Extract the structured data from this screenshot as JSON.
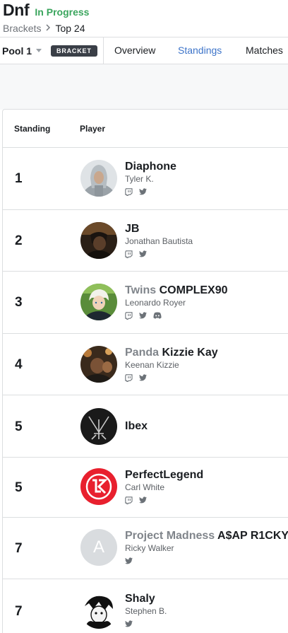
{
  "header": {
    "title": "Dnf",
    "status": "In Progress",
    "breadcrumb": {
      "parent": "Brackets",
      "current": "Top 24"
    }
  },
  "tabbar": {
    "pool_label": "Pool 1",
    "bracket_badge": "BRACKET",
    "tabs": [
      {
        "label": "Overview",
        "active": false
      },
      {
        "label": "Standings",
        "active": true
      },
      {
        "label": "Matches",
        "active": false
      }
    ]
  },
  "table": {
    "headers": {
      "standing": "Standing",
      "player": "Player"
    },
    "rows": [
      {
        "standing": "1",
        "prefix": "",
        "gamertag": "Diaphone",
        "name": "Tyler K.",
        "socials": [
          "twitch-icon",
          "twitter-icon"
        ]
      },
      {
        "standing": "2",
        "prefix": "",
        "gamertag": "JB",
        "name": "Jonathan Bautista",
        "socials": [
          "twitch-icon",
          "twitter-icon"
        ]
      },
      {
        "standing": "3",
        "prefix": "Twins",
        "gamertag": "COMPLEX90",
        "name": "Leonardo Royer",
        "socials": [
          "twitch-icon",
          "twitter-icon",
          "discord-icon"
        ]
      },
      {
        "standing": "4",
        "prefix": "Panda",
        "gamertag": "Kizzie Kay",
        "name": "Keenan Kizzie",
        "socials": [
          "twitch-icon",
          "twitter-icon"
        ]
      },
      {
        "standing": "5",
        "prefix": "",
        "gamertag": "Ibex",
        "name": "",
        "socials": []
      },
      {
        "standing": "5",
        "prefix": "",
        "gamertag": "PerfectLegend",
        "name": "Carl White",
        "socials": [
          "twitch-icon",
          "twitter-icon"
        ]
      },
      {
        "standing": "7",
        "prefix": "Project Madness",
        "gamertag": "A$AP R1CKY",
        "name": "Ricky Walker",
        "avatar_letter": "A",
        "socials": [
          "twitter-icon"
        ]
      },
      {
        "standing": "7",
        "prefix": "",
        "gamertag": "Shaly",
        "name": "Stephen B.",
        "socials": [
          "twitter-icon"
        ]
      }
    ]
  },
  "colors": {
    "status_green": "#3aa55d",
    "active_tab_blue": "#3d74c9",
    "badge_dark": "#3a3f47",
    "border": "#dcdee0",
    "prefix_gray": "#80858b"
  }
}
